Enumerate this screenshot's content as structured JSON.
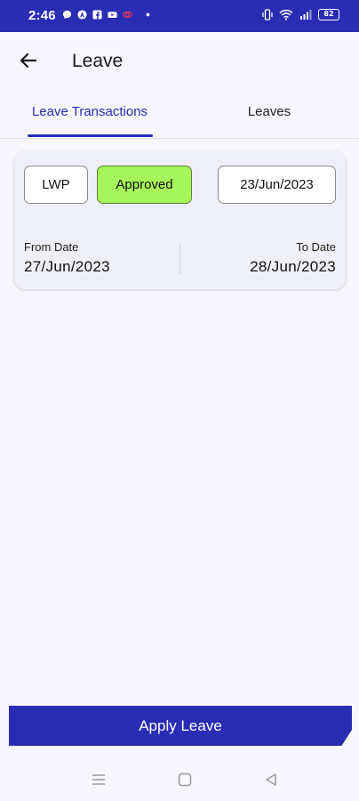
{
  "status_bar": {
    "time": "2:46",
    "battery": "82",
    "icons_left": [
      "chat-icon",
      "app-icon",
      "facebook-icon",
      "youtube-icon",
      "notification-icon",
      "dot-icon"
    ],
    "icons_right": [
      "vibrate-icon",
      "wifi-icon",
      "signal-icon",
      "battery-icon"
    ]
  },
  "header": {
    "title": "Leave"
  },
  "tabs": [
    {
      "label": "Leave Transactions",
      "active": true
    },
    {
      "label": "Leaves",
      "active": false
    }
  ],
  "card": {
    "type": "LWP",
    "status": "Approved",
    "date": "23/Jun/2023",
    "from_label": "From Date",
    "from_value": "27/Jun/2023",
    "to_label": "To Date",
    "to_value": "28/Jun/2023"
  },
  "footer": {
    "apply_label": "Apply Leave"
  },
  "colors": {
    "primary": "#2a2db3",
    "approved": "#a6f55a",
    "background": "#f7f6fd",
    "card": "#efeff9"
  }
}
